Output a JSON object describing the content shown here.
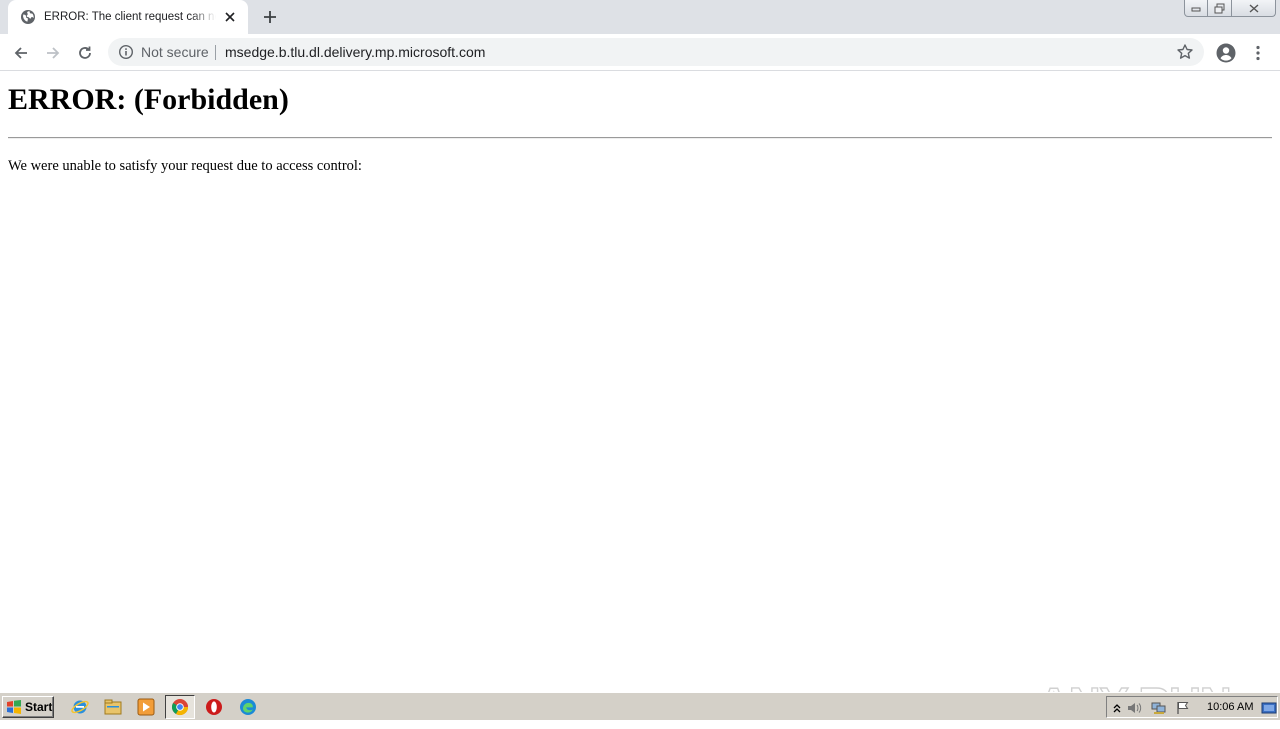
{
  "browser": {
    "tab": {
      "title": "ERROR: The client request can not be satisfied",
      "favicon": "globe-icon",
      "close_icon": "close-icon"
    },
    "new_tab_icon": "plus-icon",
    "window_controls": [
      "minimize-icon",
      "restore-icon",
      "close-icon"
    ],
    "toolbar": {
      "back_icon": "back-arrow-icon",
      "forward_icon": "forward-arrow-icon",
      "reload_icon": "reload-icon",
      "security_label": "Not secure",
      "url": "msedge.b.tlu.dl.delivery.mp.microsoft.com",
      "bookmark_icon": "star-icon",
      "profile_icon": "account-icon",
      "menu_icon": "kebab-menu-icon"
    }
  },
  "page": {
    "heading": "ERROR: (Forbidden)",
    "message": "We were unable to satisfy your request due to access control:",
    "watermark": "ANY RUN"
  },
  "taskbar": {
    "start_label": "Start",
    "quick_launch": [
      "internet-explorer-icon",
      "file-explorer-icon",
      "media-player-icon",
      "chrome-icon",
      "opera-icon",
      "edge-icon"
    ],
    "tray_icons": [
      "show-hidden-icons-icon",
      "volume-icon",
      "network-icon",
      "action-center-flag-icon"
    ],
    "clock": "10:06 AM",
    "show_desktop_icon": "show-desktop-icon"
  },
  "colors": {
    "tabstrip": "#dee1e6",
    "omnibox": "#f1f3f4",
    "taskbar": "#d4d0c8",
    "text_primary": "#202124",
    "text_secondary": "#5f6368"
  }
}
